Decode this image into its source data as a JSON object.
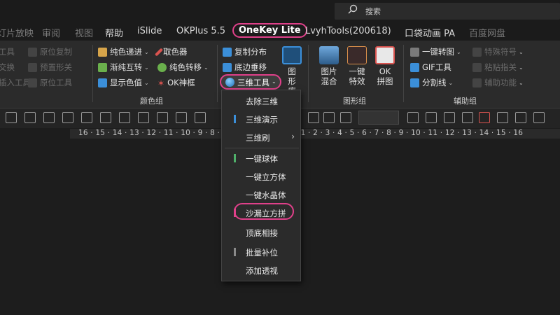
{
  "search": {
    "placeholder": "搜索",
    "icon": "search-icon"
  },
  "tabs": [
    {
      "label": "灯片放映",
      "dim": true
    },
    {
      "label": "审阅",
      "dim": true
    },
    {
      "label": "视图",
      "dim": true
    },
    {
      "label": "帮助",
      "dim": false
    },
    {
      "label": "iSlide",
      "dim": false
    },
    {
      "label": "OKPlus 5.5",
      "dim": false
    },
    {
      "label": "OneKey Lite",
      "active": true
    },
    {
      "label": "LvyhTools(200618)",
      "dim": false
    },
    {
      "label": "口袋动画 PA",
      "dim": false
    },
    {
      "label": "百度网盘",
      "dim": true
    }
  ],
  "ribbon": {
    "left_dim_items": [
      "工具",
      "原位复制",
      "交换",
      "预置形关",
      "插入工具",
      "原位工具"
    ],
    "color_group": {
      "items": [
        "纯色递进",
        "取色器",
        "渐纯互转",
        "纯色转移",
        "显示色值",
        "OK神框"
      ],
      "label": "颜色组"
    },
    "shape_group": {
      "items": [
        "复制分布",
        "底边垂移",
        "三维工具"
      ],
      "big_lib": "图形库",
      "big_blend": "图片混合",
      "big_effect": "一键特效",
      "big_okgrid": "OK拼图",
      "label": "图形组"
    },
    "assist_group": {
      "items": [
        "一键转图",
        "特殊符号",
        "GIF工具",
        "粘贴指关",
        "分割线",
        "辅助功能"
      ],
      "label": "辅助组"
    },
    "accent_colors": {
      "pink_highlight": "#e0408a",
      "blue": "#3b8fd9",
      "green": "#4fb06a",
      "red": "#d9534f"
    }
  },
  "ruler": {
    "numbers": "16 · 15 · 14 · 13 · 12 · 11 · 10 · 9 · 8 ·        · 5 · 4 · 3 · 2 · 1 · 0 · 1 · 2 · 3 · 4 · 5 · 6 · 7 · 8 · 9 · 10 · 11 · 12 · 13 · 14 · 15 · 16"
  },
  "menu": {
    "items": [
      {
        "label": "去除三维"
      },
      {
        "label": "三维演示",
        "mark": "#3b8fd9"
      },
      {
        "label": "三维刷",
        "submenu": "›"
      },
      {
        "label": "一键球体",
        "mark": "#4fb06a"
      },
      {
        "label": "一键立方体"
      },
      {
        "label": "一键水晶体"
      },
      {
        "label": "沙漏立方拼",
        "mark": "#e0408a"
      },
      {
        "label": "顶底相接"
      },
      {
        "label": "批量补位",
        "mark": "#8a8a8a"
      },
      {
        "label": "添加透视"
      }
    ]
  }
}
